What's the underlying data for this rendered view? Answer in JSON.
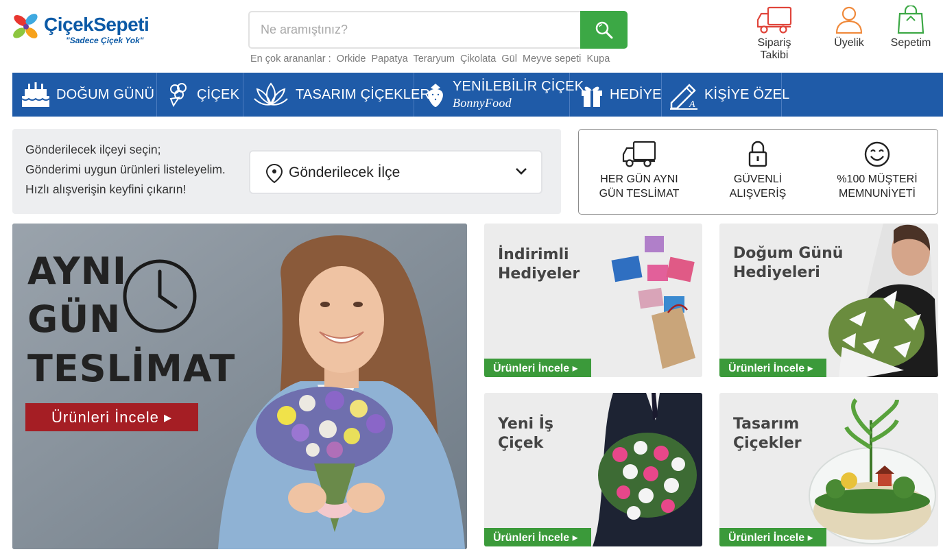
{
  "header": {
    "logo_name": "ÇiçekSepeti",
    "logo_tagline": "\"Sadece Çiçek Yok\"",
    "search_placeholder": "Ne aramıştınız?",
    "popular_label": "En çok arananlar :",
    "popular_terms": [
      "Orkide",
      "Papatya",
      "Teraryum",
      "Çikolata",
      "Gül",
      "Meyve sepeti",
      "Kupa"
    ],
    "actions": {
      "order_tracking": "Sipariş Takibi",
      "membership": "Üyelik",
      "cart": "Sepetim"
    }
  },
  "nav": {
    "items": [
      {
        "label": "DOĞUM GÜNÜ",
        "icon": "birthday-cake-icon"
      },
      {
        "label": "ÇİÇEK",
        "icon": "flower-bouquet-icon"
      },
      {
        "label": "TASARIM ÇİÇEKLER",
        "icon": "lotus-icon"
      },
      {
        "label": "YENİLEBİLİR ÇİÇEK",
        "sub": "BonnyFood",
        "icon": "strawberry-icon"
      },
      {
        "label": "HEDİYE",
        "icon": "gift-icon"
      },
      {
        "label": "KİŞİYE ÖZEL",
        "icon": "pen-icon"
      }
    ]
  },
  "district": {
    "line1": "Gönderilecek ilçeyi seçin;",
    "line2": "Gönderimi uygun ürünleri listeleyelim.",
    "line3": "Hızlı alışverişin keyfini çıkarın!",
    "select_label": "Gönderilecek İlçe"
  },
  "features": [
    {
      "line1": "HER GÜN AYNI",
      "line2": "GÜN TESLİMAT",
      "icon": "truck-icon"
    },
    {
      "line1": "GÜVENLİ",
      "line2": "ALIŞVERİŞ",
      "icon": "lock-icon"
    },
    {
      "line1": "%100 MÜŞTERİ",
      "line2": "MEMNUNİYETİ",
      "icon": "smiley-icon"
    }
  ],
  "hero": {
    "line1": "AYNI",
    "line2": "GÜN",
    "line3": "TESLİMAT",
    "button": "Ürünleri İncele ▸"
  },
  "tiles": [
    {
      "line1": "İndirimli",
      "line2": "Hediyeler",
      "button": "Ürünleri İncele ▸"
    },
    {
      "line1": "Doğum Günü",
      "line2": "Hediyeleri",
      "button": "Ürünleri İncele ▸"
    },
    {
      "line1": "Yeni İş",
      "line2": "Çiçek",
      "button": "Ürünleri İncele ▸"
    },
    {
      "line1": "Tasarım",
      "line2": "Çiçekler",
      "button": "Ürünleri İncele ▸"
    }
  ],
  "colors": {
    "brand_blue": "#1f5ba8",
    "search_green": "#3ca845",
    "hero_red": "#a51e24",
    "tile_green": "#3b9a3a"
  }
}
